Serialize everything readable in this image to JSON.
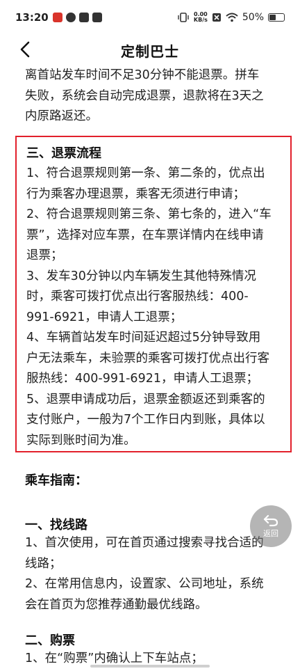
{
  "status_bar": {
    "time": "13:20",
    "net_speed_top": "0.00",
    "net_speed_bottom": "KB/s",
    "battery": "50%"
  },
  "nav": {
    "title": "定制巴士"
  },
  "intro": {
    "lines": [
      "离首站发车时间不足30分钟不能退票。拼车",
      "失败，系统会自动完成退票，退款将在3天之",
      "内原路返还。"
    ]
  },
  "refund": {
    "title": "三、退票流程",
    "lines": [
      "1、符合退票规则第一条、第二条的，优点出",
      "行为乘客办理退票，乘客无须进行申请；",
      "2、符合退票规则第三条、第七条的，进入“车",
      "票”，选择对应车票，在车票详情内在线申请",
      "退票；",
      "3、发车30分钟以内车辆发生其他特殊情况",
      "时，乘客可拨打优点出行客服热线：400-",
      "991-6921，申请人工退票；",
      "4、车辆首站发车时间延迟超过5分钟导致用",
      "户无法乘车，未验票的乘客可拨打优点出行客",
      "服热线：400-991-6921，申请人工退票；",
      "5、退票申请成功后，退票金额返还到乘客的",
      "支付账户，一般为7个工作日内到账，具体以",
      "实际到账时间为准。"
    ]
  },
  "guide": {
    "title": "乘车指南："
  },
  "find_route": {
    "title": "一、找线路",
    "lines": [
      "1、首次使用，可在首页通过搜索寻找合适的",
      "线路；",
      "2、在常用信息内，设置家、公司地址，系统",
      "会在首页为您推荐通勤最优线路。"
    ]
  },
  "buy": {
    "title": "二、购票",
    "lines": [
      "1、在“购票”内确认上下车站点；"
    ]
  },
  "float_button": {
    "label": "返回"
  }
}
